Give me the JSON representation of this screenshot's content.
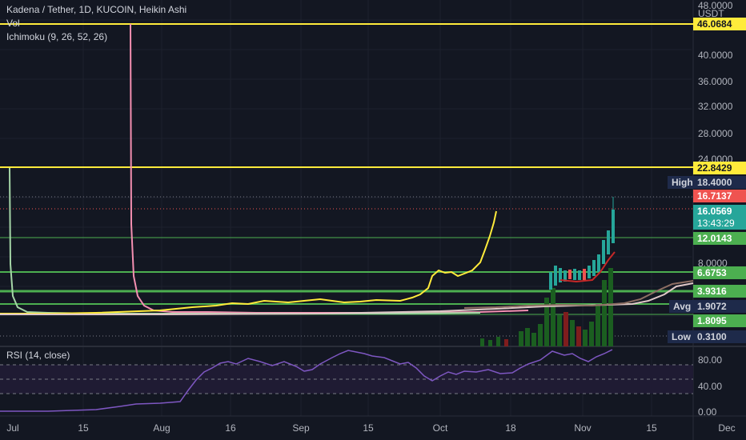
{
  "header": {
    "title": "Kadena / Tether, 1D, KUCOIN, Heikin Ashi",
    "vol": "Vol",
    "ichimoku": "Ichimoku (9, 26, 52, 26)",
    "rsi": "RSI (14, close)"
  },
  "price_axis": {
    "unit": "USDT",
    "ticks": [
      "48.0000",
      "40.0000",
      "36.0000",
      "32.0000",
      "28.0000",
      "24.0000",
      "8.0000"
    ]
  },
  "rsi_axis": {
    "ticks": [
      "80.00",
      "40.00",
      "0.00"
    ]
  },
  "time_axis": {
    "ticks": [
      "Jul",
      "15",
      "Aug",
      "16",
      "Sep",
      "15",
      "Oct",
      "18",
      "Nov",
      "15",
      "Dec"
    ]
  },
  "price_tags": {
    "top_yellow": "46.0684",
    "yellow_2": "22.8429",
    "high_label": "High",
    "high": "18.4000",
    "red": "16.7137",
    "last": "16.0569",
    "countdown": "13:43:29",
    "g1": "12.0143",
    "g2": "6.6753",
    "g3": "3.9316",
    "avg_label": "Avg",
    "avg": "1.9072",
    "g4": "1.8095",
    "low_label": "Low",
    "low": "0.3100"
  },
  "colors": {
    "background": "#131722",
    "up": "#26a69a",
    "down": "#ef5350",
    "yellow": "#ffeb3b",
    "green_line": "#4caf50",
    "rsi": "#7e57c2"
  }
}
